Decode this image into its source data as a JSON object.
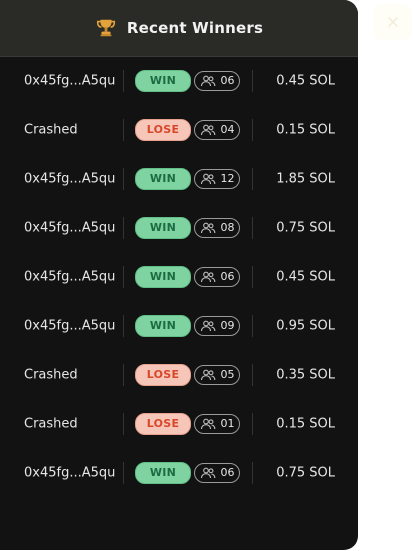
{
  "header": {
    "title": "Recent Winners",
    "trophy_icon": "trophy-icon"
  },
  "close": {
    "icon": "close-icon"
  },
  "winners": [
    {
      "player": "0x45fg...A5qu",
      "result": "WIN",
      "players": "06",
      "amount": "0.45 SOL"
    },
    {
      "player": "Crashed",
      "result": "LOSE",
      "players": "04",
      "amount": "0.15 SOL"
    },
    {
      "player": "0x45fg...A5qu",
      "result": "WIN",
      "players": "12",
      "amount": "1.85 SOL"
    },
    {
      "player": "0x45fg...A5qu",
      "result": "WIN",
      "players": "08",
      "amount": "0.75 SOL"
    },
    {
      "player": "0x45fg...A5qu",
      "result": "WIN",
      "players": "06",
      "amount": "0.45 SOL"
    },
    {
      "player": "0x45fg...A5qu",
      "result": "WIN",
      "players": "09",
      "amount": "0.95 SOL"
    },
    {
      "player": "Crashed",
      "result": "LOSE",
      "players": "05",
      "amount": "0.35 SOL"
    },
    {
      "player": "Crashed",
      "result": "LOSE",
      "players": "01",
      "amount": "0.15 SOL"
    },
    {
      "player": "0x45fg...A5qu",
      "result": "WIN",
      "players": "06",
      "amount": "0.75 SOL"
    }
  ],
  "colors": {
    "panel_bg": "#121212",
    "header_bg": "#2a2a26",
    "win_bg": "#7fd3a1",
    "win_text": "#1d6b43",
    "lose_bg": "#f6c6b9",
    "lose_text": "#d9472b"
  }
}
